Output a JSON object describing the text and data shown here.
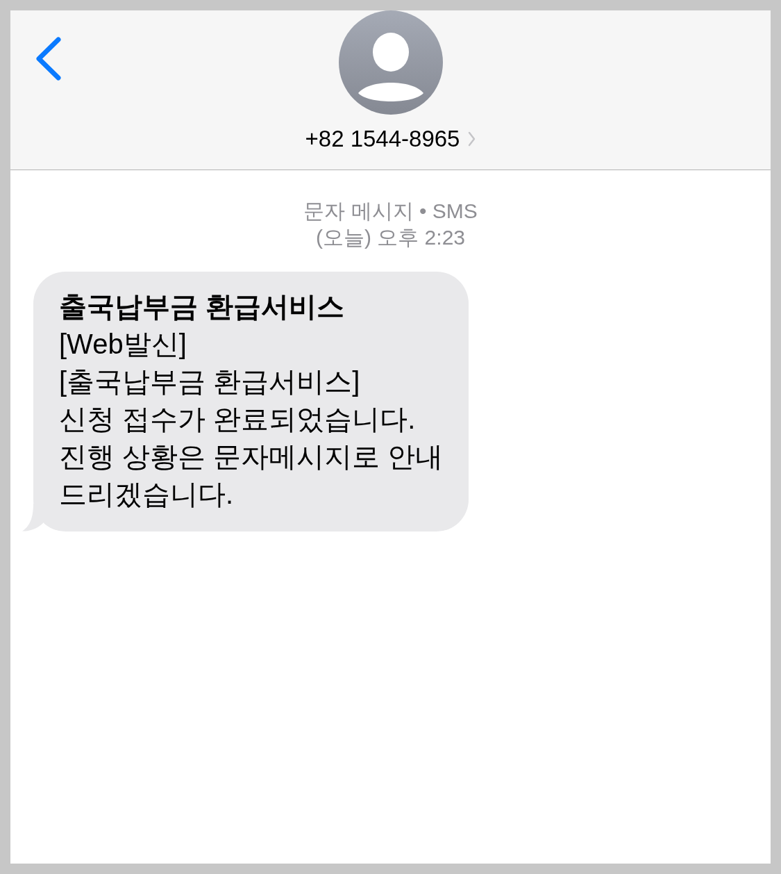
{
  "header": {
    "contact": {
      "phone": "+82 1544-8965"
    }
  },
  "conversation": {
    "service_label": "문자 메시지 • SMS",
    "timestamp": "(오늘) 오후 2:23",
    "messages": [
      {
        "title": "출국납부금 환급서비스",
        "lines": [
          "[Web발신]",
          "[출국납부금 환급서비스]",
          "신청 접수가 완료되었습니다.",
          "진행 상황은 문자메시지로 안내",
          "드리겠습니다."
        ]
      }
    ]
  }
}
